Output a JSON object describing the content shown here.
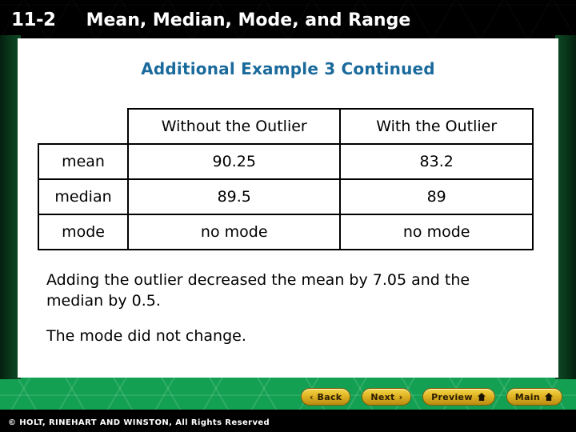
{
  "header": {
    "lesson_number": "11-2",
    "lesson_title": "Mean, Median, Mode, and Range"
  },
  "content": {
    "subtitle": "Additional Example 3 Continued",
    "subtitle_color": "#1b6a9c",
    "paragraphs": [
      "Adding the outlier decreased the mean by 7.05 and the median by 0.5.",
      "The mode did not change."
    ]
  },
  "table": {
    "corner_label": "",
    "columns": [
      "",
      "Without the Outlier",
      "With the Outlier"
    ],
    "rows": [
      {
        "label": "mean",
        "without": "90.25",
        "with": "83.2"
      },
      {
        "label": "median",
        "without": "89.5",
        "with": "89"
      },
      {
        "label": "mode",
        "without": "no mode",
        "with": "no mode"
      }
    ]
  },
  "nav": {
    "buttons": [
      {
        "label": "Back",
        "icon": "chevron-left-icon",
        "glyph": "‹"
      },
      {
        "label": "Next",
        "icon": "chevron-right-icon",
        "glyph": "›"
      },
      {
        "label": "Preview",
        "icon": "home-icon",
        "glyph": ""
      },
      {
        "label": "Main",
        "icon": "home-icon",
        "glyph": ""
      }
    ]
  },
  "footer": {
    "copyright": "© HOLT, RINEHART AND WINSTON, All Rights Reserved"
  },
  "theme": {
    "green": "#13a052",
    "gold": "#e0b524",
    "header_bg": "#000000",
    "panel_bg": "#ffffff"
  }
}
